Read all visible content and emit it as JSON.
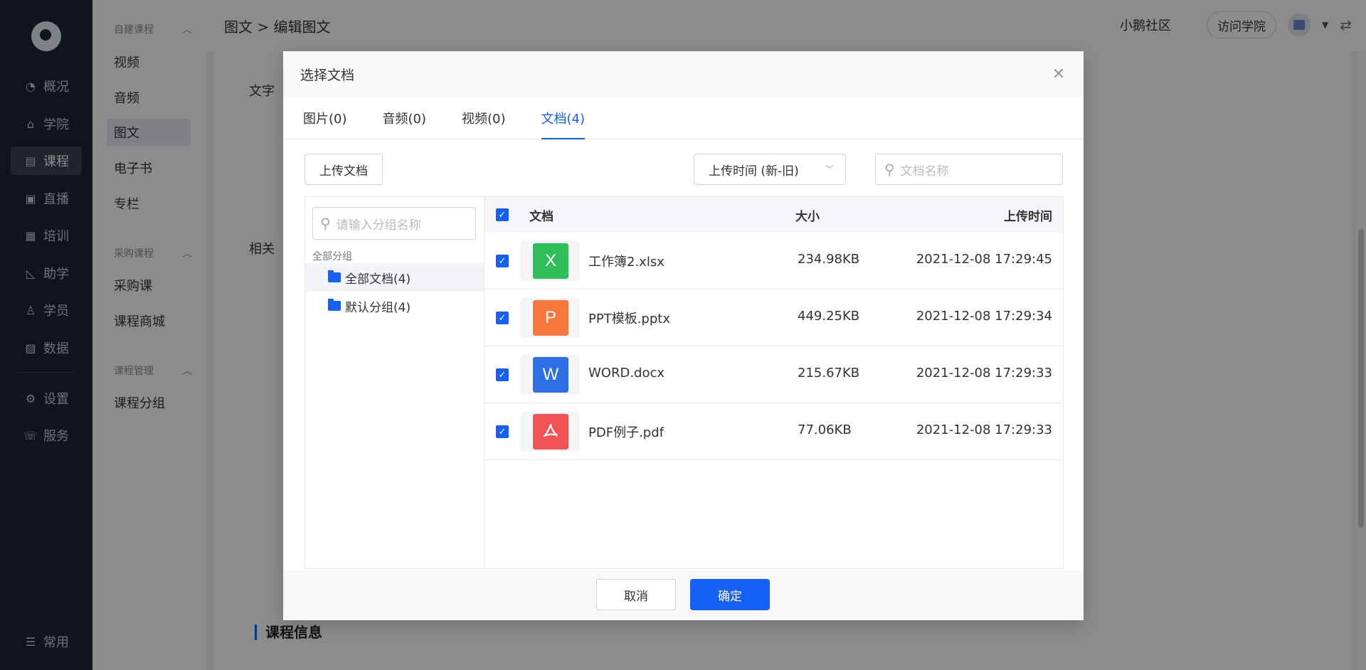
{
  "nav": {
    "items": [
      {
        "label": "概况",
        "icon": "pie-chart-icon"
      },
      {
        "label": "学院",
        "icon": "school-icon"
      },
      {
        "label": "课程",
        "icon": "book-icon",
        "active": true
      },
      {
        "label": "直播",
        "icon": "live-icon"
      },
      {
        "label": "培训",
        "icon": "training-icon"
      },
      {
        "label": "助学",
        "icon": "study-icon"
      },
      {
        "label": "学员",
        "icon": "user-icon"
      },
      {
        "label": "数据",
        "icon": "data-icon"
      },
      {
        "label": "设置",
        "icon": "gear-icon"
      },
      {
        "label": "服务",
        "icon": "service-icon"
      }
    ],
    "bottom": {
      "label": "常用",
      "icon": "list-icon"
    }
  },
  "subnav": {
    "group1": "自建课程",
    "group1_items": [
      "视频",
      "音频",
      "图文",
      "电子书",
      "专栏"
    ],
    "group2": "采购课程",
    "group2_items": [
      "采购课",
      "课程商城"
    ],
    "group3": "课程管理",
    "group3_items": [
      "课程分组"
    ]
  },
  "topbar": {
    "breadcrumb": "图文 > 编辑图文",
    "community": "小鹅社区",
    "visit": "访问学院"
  },
  "content": {
    "label1": "文字",
    "label2": "相关",
    "section_title": "课程信息"
  },
  "modal": {
    "title": "选择文档",
    "tabs": [
      "图片(0)",
      "音频(0)",
      "视频(0)",
      "文档(4)"
    ],
    "active_tab": 3,
    "upload_label": "上传文档",
    "sort_value": "上传时间 (新-旧)",
    "search_placeholder": "文档名称",
    "group_search_placeholder": "请输入分组名称",
    "group_title": "全部分组",
    "groups": [
      "全部文档(4)",
      "默认分组(4)"
    ],
    "columns": {
      "doc": "文档",
      "size": "大小",
      "time": "上传时间"
    },
    "files": [
      {
        "name": "工作簿2.xlsx",
        "size": "234.98KB",
        "time": "2021-12-08 17:29:45",
        "type": "X",
        "color": "#2fbf5a"
      },
      {
        "name": "PPT模板.pptx",
        "size": "449.25KB",
        "time": "2021-12-08 17:29:34",
        "type": "P",
        "color": "#f5773a"
      },
      {
        "name": "WORD.docx",
        "size": "215.67KB",
        "time": "2021-12-08 17:29:33",
        "type": "W",
        "color": "#2d6fe4"
      },
      {
        "name": "PDF例子.pdf",
        "size": "77.06KB",
        "time": "2021-12-08 17:29:33",
        "type": "pdf",
        "color": "#f25454"
      }
    ],
    "cancel_label": "取消",
    "ok_label": "确定"
  },
  "colors": {
    "primary": "#1660f5",
    "nav_bg": "#1f2435"
  }
}
